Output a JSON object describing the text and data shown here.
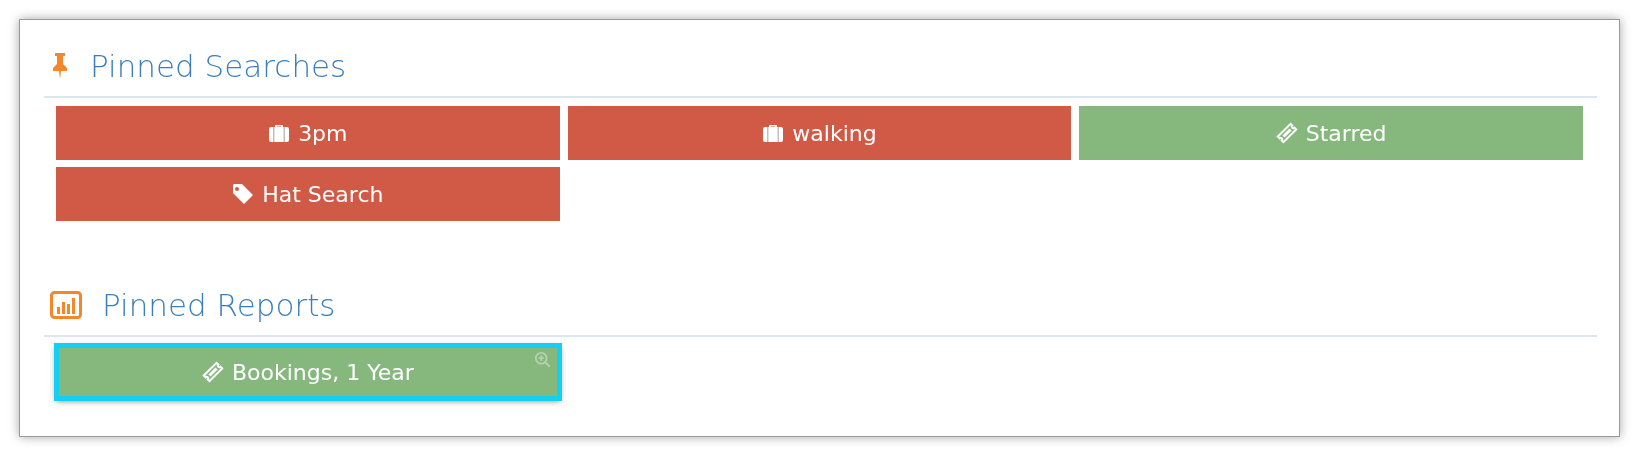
{
  "sections": [
    {
      "title": "Pinned Searches",
      "kind": "pin",
      "items": [
        {
          "label": "3pm",
          "kind": "briefcase",
          "color": "#d05a46",
          "selected": false
        },
        {
          "label": "walking",
          "kind": "briefcase",
          "color": "#d05a46",
          "selected": false
        },
        {
          "label": "Starred",
          "kind": "ticket",
          "color": "#86b87e",
          "selected": false
        },
        {
          "label": "Hat Search",
          "kind": "tag",
          "color": "#d05a46",
          "selected": false
        }
      ]
    },
    {
      "title": "Pinned Reports",
      "kind": "chart",
      "items": [
        {
          "label": "Bookings, 1 Year",
          "kind": "ticket",
          "color": "#86b87e",
          "selected": true,
          "zoom": true
        }
      ]
    }
  ]
}
